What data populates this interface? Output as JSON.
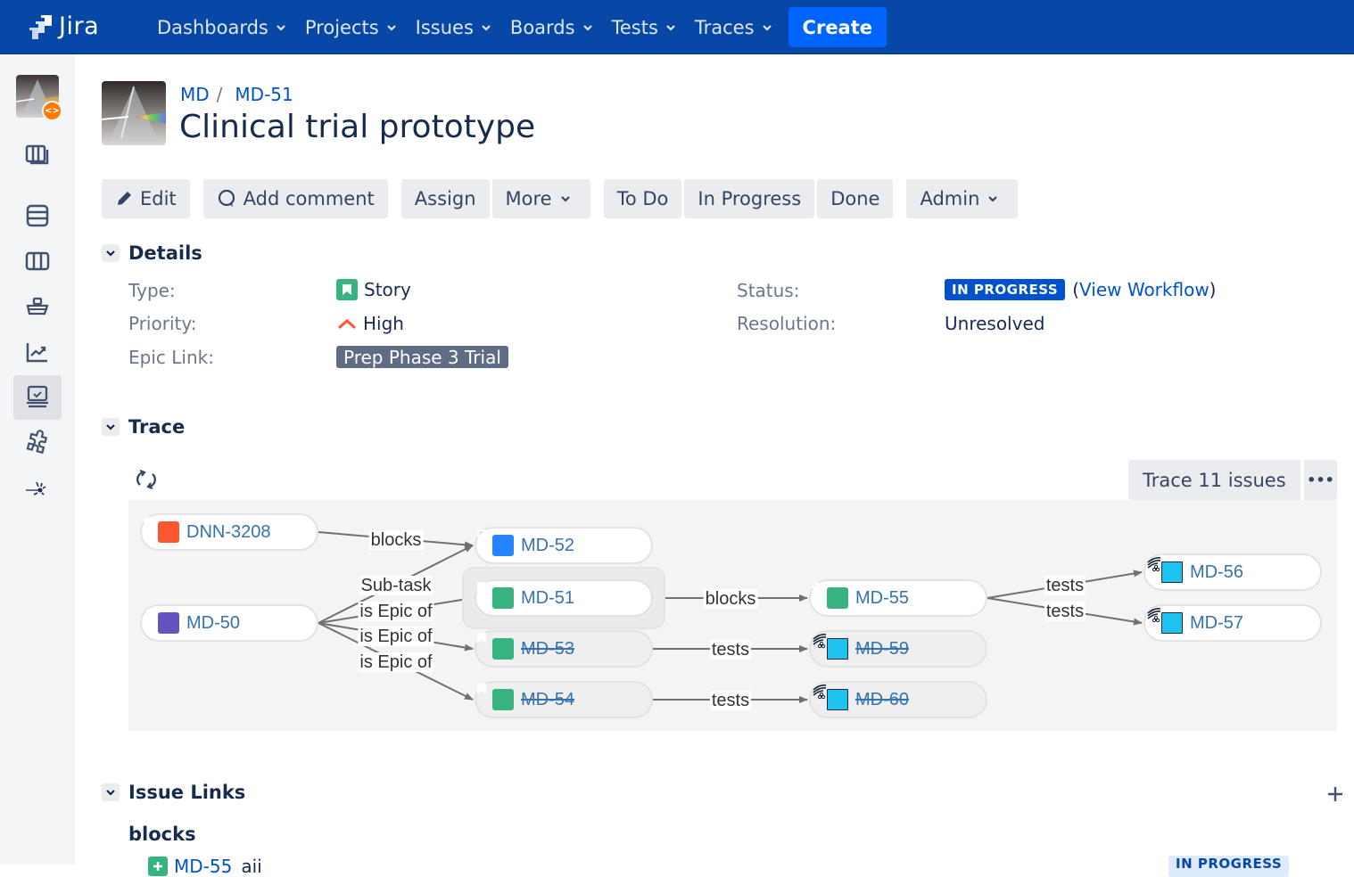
{
  "app": {
    "name": "Jira"
  },
  "nav": {
    "items": [
      {
        "label": "Dashboards"
      },
      {
        "label": "Projects"
      },
      {
        "label": "Issues"
      },
      {
        "label": "Boards"
      },
      {
        "label": "Tests"
      },
      {
        "label": "Traces"
      }
    ],
    "create_label": "Create"
  },
  "sidebar": {
    "items": [
      {
        "icon": "backlog-icon"
      },
      {
        "icon": "board-stack-icon"
      },
      {
        "icon": "board-columns-icon"
      },
      {
        "icon": "releases-ship-icon"
      },
      {
        "icon": "reports-chart-icon"
      },
      {
        "icon": "test-monitor-icon",
        "active": true
      },
      {
        "icon": "add-ons-puzzle-icon"
      },
      {
        "icon": "tracer-icon"
      }
    ]
  },
  "breadcrumb": {
    "project": "MD",
    "separator": "/",
    "issue_key": "MD-51"
  },
  "issue": {
    "title": "Clinical trial prototype"
  },
  "toolbar": {
    "edit": "Edit",
    "add_comment": "Add comment",
    "assign": "Assign",
    "more": "More",
    "to_do": "To Do",
    "in_progress": "In Progress",
    "done": "Done",
    "admin": "Admin"
  },
  "details": {
    "title": "Details",
    "type_label": "Type:",
    "type_value": "Story",
    "priority_label": "Priority:",
    "priority_value": "High",
    "epic_label": "Epic Link:",
    "epic_value": "Prep Phase 3 Trial",
    "status_label": "Status:",
    "status_value": "IN PROGRESS",
    "status_open_paren": "(",
    "view_workflow": "View Workflow",
    "status_close_paren": ")",
    "resolution_label": "Resolution:",
    "resolution_value": "Unresolved",
    "colors": {
      "story": "#36b37e",
      "priority_high": "#ff5630",
      "status": "#0052cc",
      "epic": "#5e6c84"
    }
  },
  "trace": {
    "title": "Trace",
    "count_button": "Trace 11 issues",
    "more_button": "•••",
    "nodes": [
      {
        "id": "DNN-3208",
        "key": "DNN-3208",
        "type": "bug",
        "resolved": false
      },
      {
        "id": "MD-50",
        "key": "MD-50",
        "type": "epic",
        "resolved": false
      },
      {
        "id": "MD-52",
        "key": "MD-52",
        "type": "subtask",
        "resolved": false
      },
      {
        "id": "MD-51",
        "key": "MD-51",
        "type": "story",
        "resolved": false,
        "current": true
      },
      {
        "id": "MD-53",
        "key": "MD-53",
        "type": "story",
        "resolved": true
      },
      {
        "id": "MD-54",
        "key": "MD-54",
        "type": "story",
        "resolved": true
      },
      {
        "id": "MD-55",
        "key": "MD-55",
        "type": "new-feature",
        "resolved": false
      },
      {
        "id": "MD-59",
        "key": "MD-59",
        "type": "test",
        "resolved": true
      },
      {
        "id": "MD-60",
        "key": "MD-60",
        "type": "test",
        "resolved": true
      },
      {
        "id": "MD-56",
        "key": "MD-56",
        "type": "test",
        "resolved": false
      },
      {
        "id": "MD-57",
        "key": "MD-57",
        "type": "test",
        "resolved": false
      }
    ],
    "edges": [
      {
        "from": "DNN-3208",
        "to": "MD-52",
        "label": "blocks"
      },
      {
        "from": "MD-50",
        "to": "MD-52",
        "label": "Sub-task"
      },
      {
        "from": "MD-50",
        "to": "MD-51",
        "label": "is Epic of"
      },
      {
        "from": "MD-50",
        "to": "MD-53",
        "label": "is Epic of"
      },
      {
        "from": "MD-50",
        "to": "MD-54",
        "label": "is Epic of"
      },
      {
        "from": "MD-51",
        "to": "MD-55",
        "label": "blocks"
      },
      {
        "from": "MD-53",
        "to": "MD-59",
        "label": "tests"
      },
      {
        "from": "MD-54",
        "to": "MD-60",
        "label": "tests"
      },
      {
        "from": "MD-55",
        "to": "MD-56",
        "label": "tests"
      },
      {
        "from": "MD-55",
        "to": "MD-57",
        "label": "tests"
      }
    ],
    "type_colors": {
      "bug": "#ff5630",
      "epic": "#6554c0",
      "subtask": "#2684ff",
      "story": "#36b37e",
      "new-feature": "#36b37e",
      "test": "#1fc3f0"
    }
  },
  "issue_links": {
    "title": "Issue Links",
    "add_label": "+",
    "groups": [
      {
        "type": "blocks",
        "items": [
          {
            "key": "MD-55",
            "summary": "aii",
            "status": "IN PROGRESS"
          }
        ]
      }
    ]
  }
}
